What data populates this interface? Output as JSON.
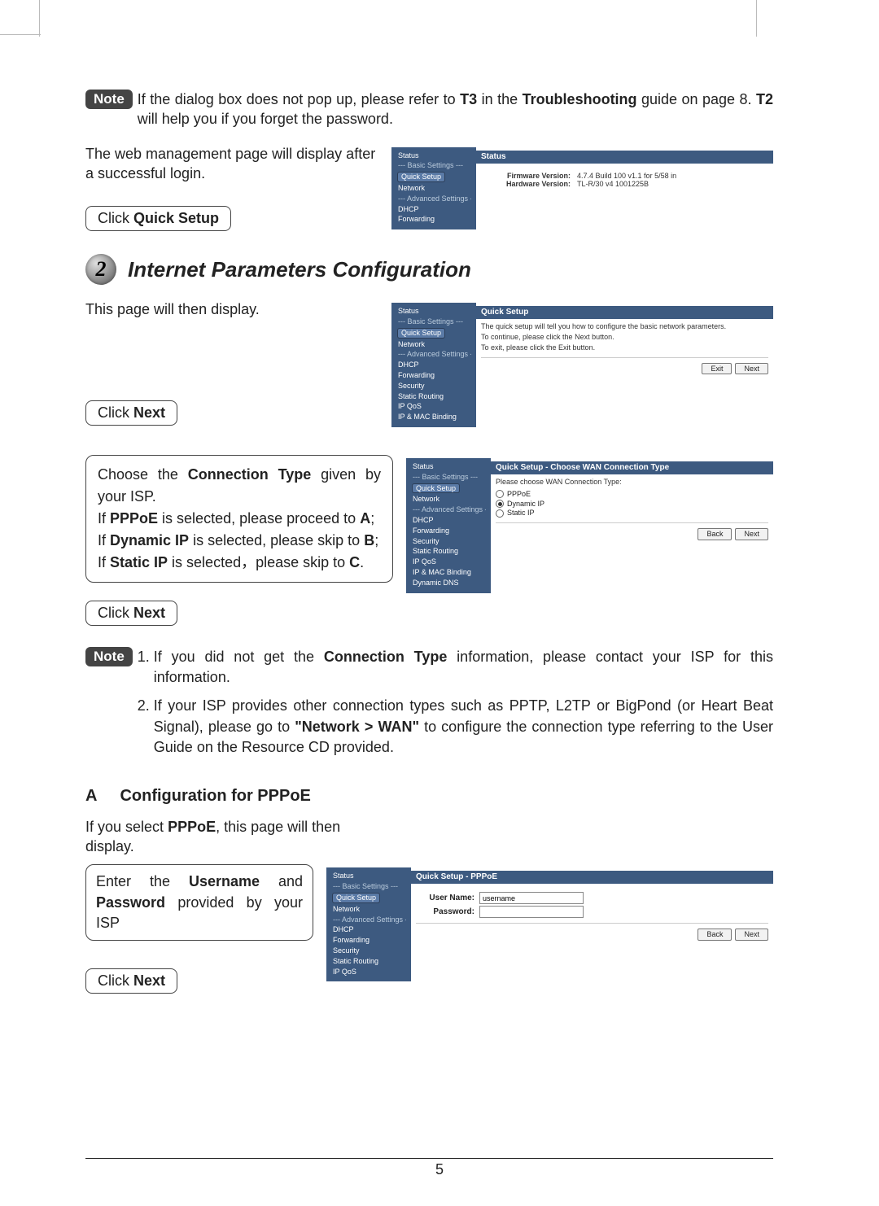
{
  "note_label": "Note",
  "note1_html": "If the dialog box does not pop up, please refer to <b>T3</b> in the <b>Troubleshooting</b> guide on page 8. <b>T2</b> will help you if you forget the password.",
  "intro_mgmt": "The web management page will display after a successful login.",
  "click_quick_setup": "Click <b>Quick Setup</b>",
  "screenshot_status": {
    "nav": [
      "Status",
      "--- Basic Settings ---",
      "Quick Setup",
      "Network",
      "--- Advanced Settings ---",
      "DHCP",
      "Forwarding"
    ],
    "title": "Status",
    "rows": [
      {
        "k": "Firmware Version:",
        "v": "4.7.4 Build 100 v1.1 for 5/58 in"
      },
      {
        "k": "Hardware Version:",
        "v": "TL-R/30 v4 1001225B"
      }
    ]
  },
  "step2_num": "2",
  "step2_title": "Internet Parameters Configuration",
  "this_page": "This page will then display.",
  "click_next": "Click <b>Next</b>",
  "screenshot_qs": {
    "nav": [
      "Status",
      "--- Basic Settings ---",
      "Quick Setup",
      "Network",
      "--- Advanced Settings ---",
      "DHCP",
      "Forwarding",
      "Security",
      "Static Routing",
      "IP QoS",
      "IP & MAC Binding"
    ],
    "title": "Quick Setup",
    "lines": [
      "The quick setup will tell you how to configure the basic network parameters.",
      "To continue, please click the Next button.",
      "To exit, please click the Exit button."
    ],
    "buttons": [
      "Exit",
      "Next"
    ]
  },
  "conn_box": "Choose the <b>Connection Type</b> given by your ISP.<br>If <b>PPPoE</b> is selected, please proceed to <b>A</b>;<br>If <b>Dynamic IP</b> is selected, please skip to <b>B</b>;<br>If <b>Static IP</b> is selected，please skip to <b>C</b>.",
  "screenshot_wan": {
    "nav": [
      "Status",
      "--- Basic Settings ---",
      "Quick Setup",
      "Network",
      "--- Advanced Settings ---",
      "DHCP",
      "Forwarding",
      "Security",
      "Static Routing",
      "IP QoS",
      "IP & MAC Binding",
      "Dynamic DNS"
    ],
    "title": "Quick Setup - Choose WAN Connection Type",
    "prompt": "Please choose WAN Connection Type:",
    "options": [
      {
        "label": "PPPoE",
        "on": false
      },
      {
        "label": "Dynamic IP",
        "on": true
      },
      {
        "label": "Static IP",
        "on": false
      }
    ],
    "buttons": [
      "Back",
      "Next"
    ]
  },
  "note2_items": [
    "If you did not get the <b>Connection Type</b> information, please contact your ISP for this information.",
    "If your ISP provides other connection types such as PPTP, L2TP or BigPond (or Heart Beat Signal), please go to <b>\"Network &gt; WAN\"</b> to configure the connection type referring to the User Guide on the Resource CD provided."
  ],
  "section_a_letter": "A",
  "section_a_title": "Configuration for PPPoE",
  "pppoe_intro": "If you select <b>PPPoE</b>, this page will then display.",
  "pppoe_box": "Enter the <b>Username</b> and <b>Password</b> provided by your ISP",
  "screenshot_pppoe": {
    "nav": [
      "Status",
      "--- Basic Settings ---",
      "Quick Setup",
      "Network",
      "--- Advanced Settings ---",
      "DHCP",
      "Forwarding",
      "Security",
      "Static Routing",
      "IP QoS"
    ],
    "title": "Quick Setup - PPPoE",
    "fields": [
      {
        "label": "User Name:",
        "value": "username"
      },
      {
        "label": "Password:",
        "value": ""
      }
    ],
    "buttons": [
      "Back",
      "Next"
    ]
  },
  "page_number": "5"
}
